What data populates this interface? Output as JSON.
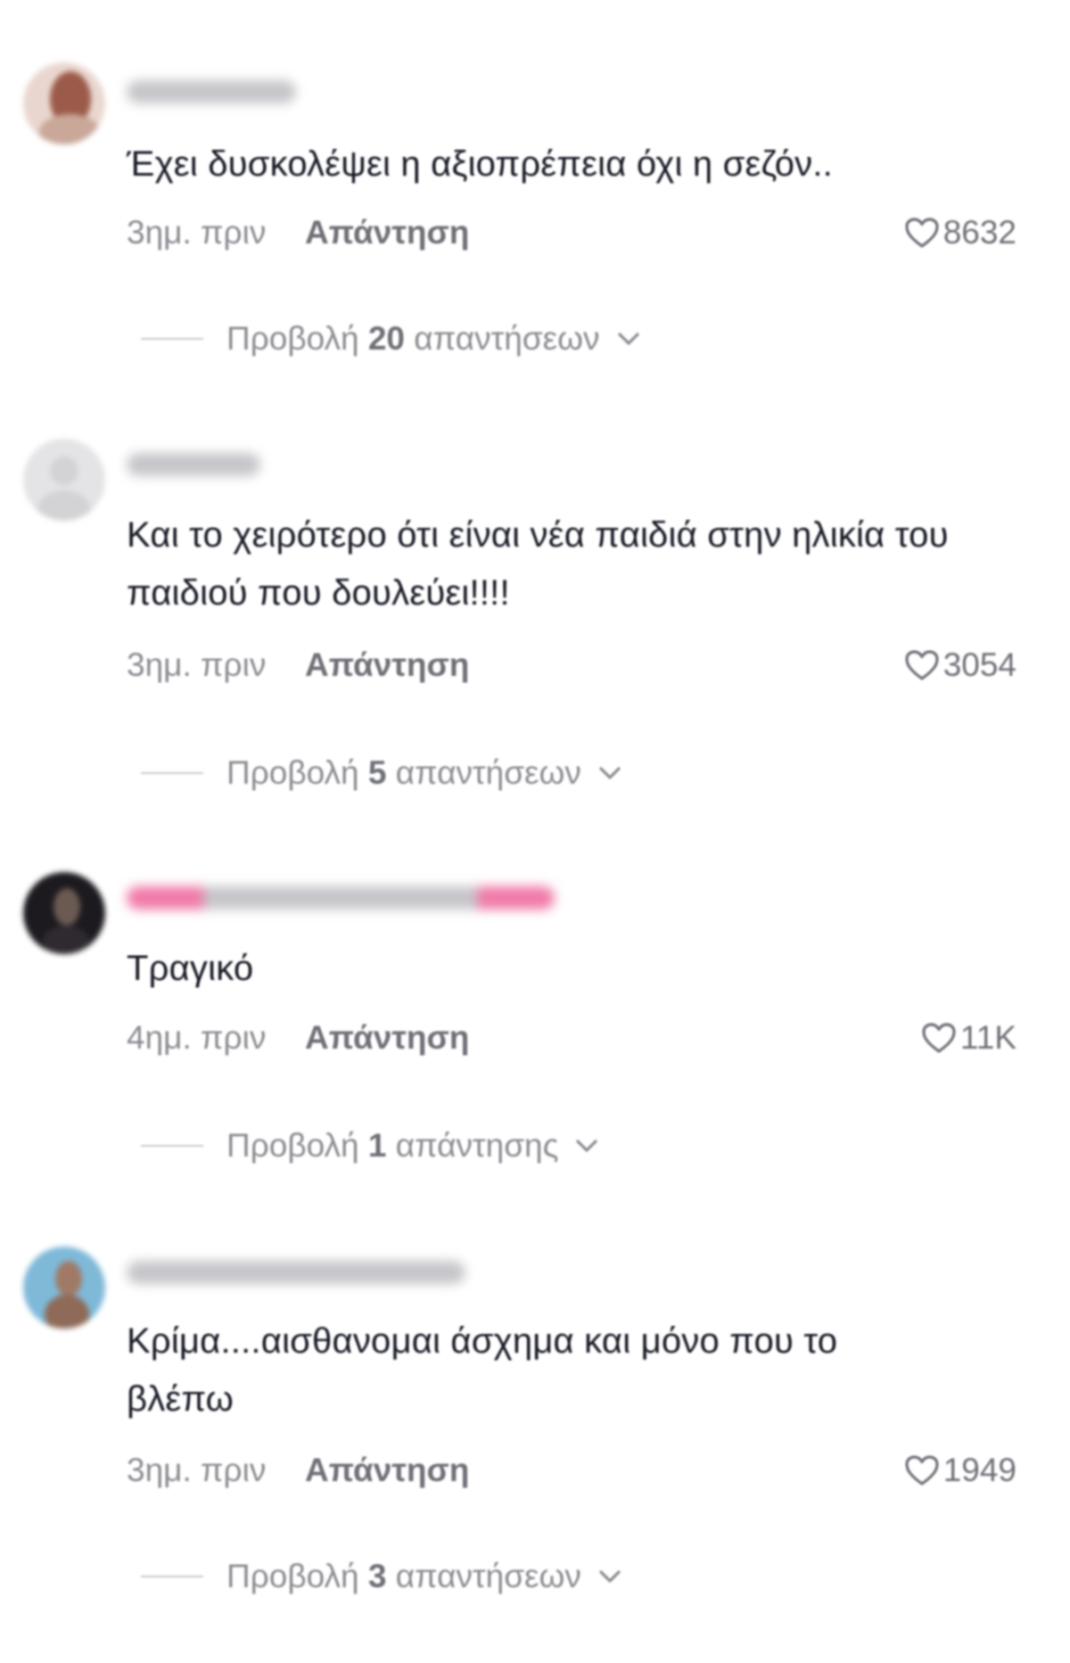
{
  "comments": [
    {
      "text": "Έχει δυσκολέψει η αξιοπρέπεια όχι η σεζόν..",
      "time": "3ημ. πριν",
      "reply_label": "Απάντηση",
      "likes": "8632",
      "view_prefix": "Προβολή",
      "view_count": "20",
      "view_suffix": "απαντήσεων"
    },
    {
      "text": "Και το χειρότερο ότι είναι νέα παιδιά στην ηλικία του παιδιού που δουλεύει!!!!",
      "time": "3ημ. πριν",
      "reply_label": "Απάντηση",
      "likes": "3054",
      "view_prefix": "Προβολή",
      "view_count": "5",
      "view_suffix": "απαντήσεων"
    },
    {
      "text": "Τραγικό",
      "time": "4ημ. πριν",
      "reply_label": "Απάντηση",
      "likes": "11K",
      "view_prefix": "Προβολή",
      "view_count": "1",
      "view_suffix": "απάντησης"
    },
    {
      "text": "Κρίμα....αισθανομαι άσχημα και μόνο που το βλέπω",
      "time": "3ημ. πριν",
      "reply_label": "Απάντηση",
      "likes": "1949",
      "view_prefix": "Προβολή",
      "view_count": "3",
      "view_suffix": "απαντήσεων"
    }
  ],
  "icons": {
    "like": "heart-icon",
    "expand": "chevron-down-icon"
  },
  "colors": {
    "text": "#161823",
    "muted": "#8a8b91",
    "action": "#6f7077"
  }
}
